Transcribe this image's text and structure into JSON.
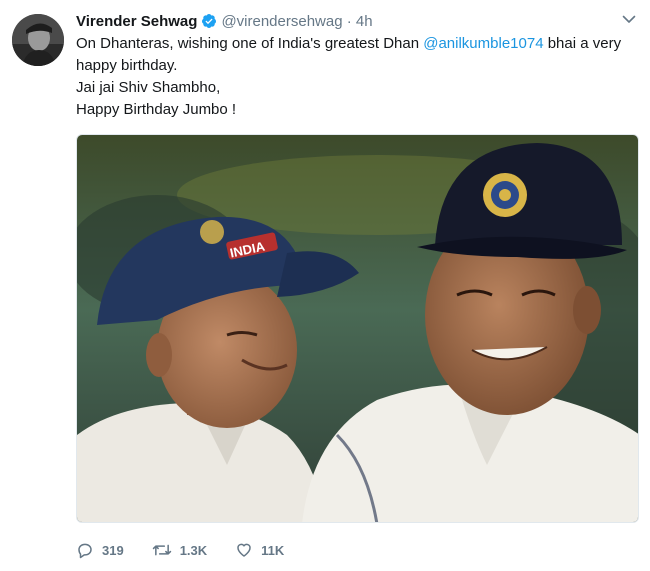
{
  "tweet": {
    "author_name": "Virender Sehwag",
    "handle": "@virendersehwag",
    "separator": "·",
    "time": "4h",
    "text_line1_pre": "On Dhanteras, wishing one of India's greatest Dhan ",
    "mention": "@anilkumble1074",
    "text_line1_post": " bhai a very happy birthday.",
    "text_line2": "Jai jai Shiv Shambho,",
    "text_line3": "Happy Birthday Jumbo !",
    "cap_text": "INDIA"
  },
  "actions": {
    "reply_count": "319",
    "retweet_count": "1.3K",
    "like_count": "11K"
  },
  "icons": {
    "verified": "verified-badge-icon",
    "menu": "chevron-down-icon",
    "reply": "reply-icon",
    "retweet": "retweet-icon",
    "like": "heart-icon"
  },
  "colors": {
    "accent": "#1da1f2",
    "link": "#1b95e0",
    "muted": "#657786"
  }
}
